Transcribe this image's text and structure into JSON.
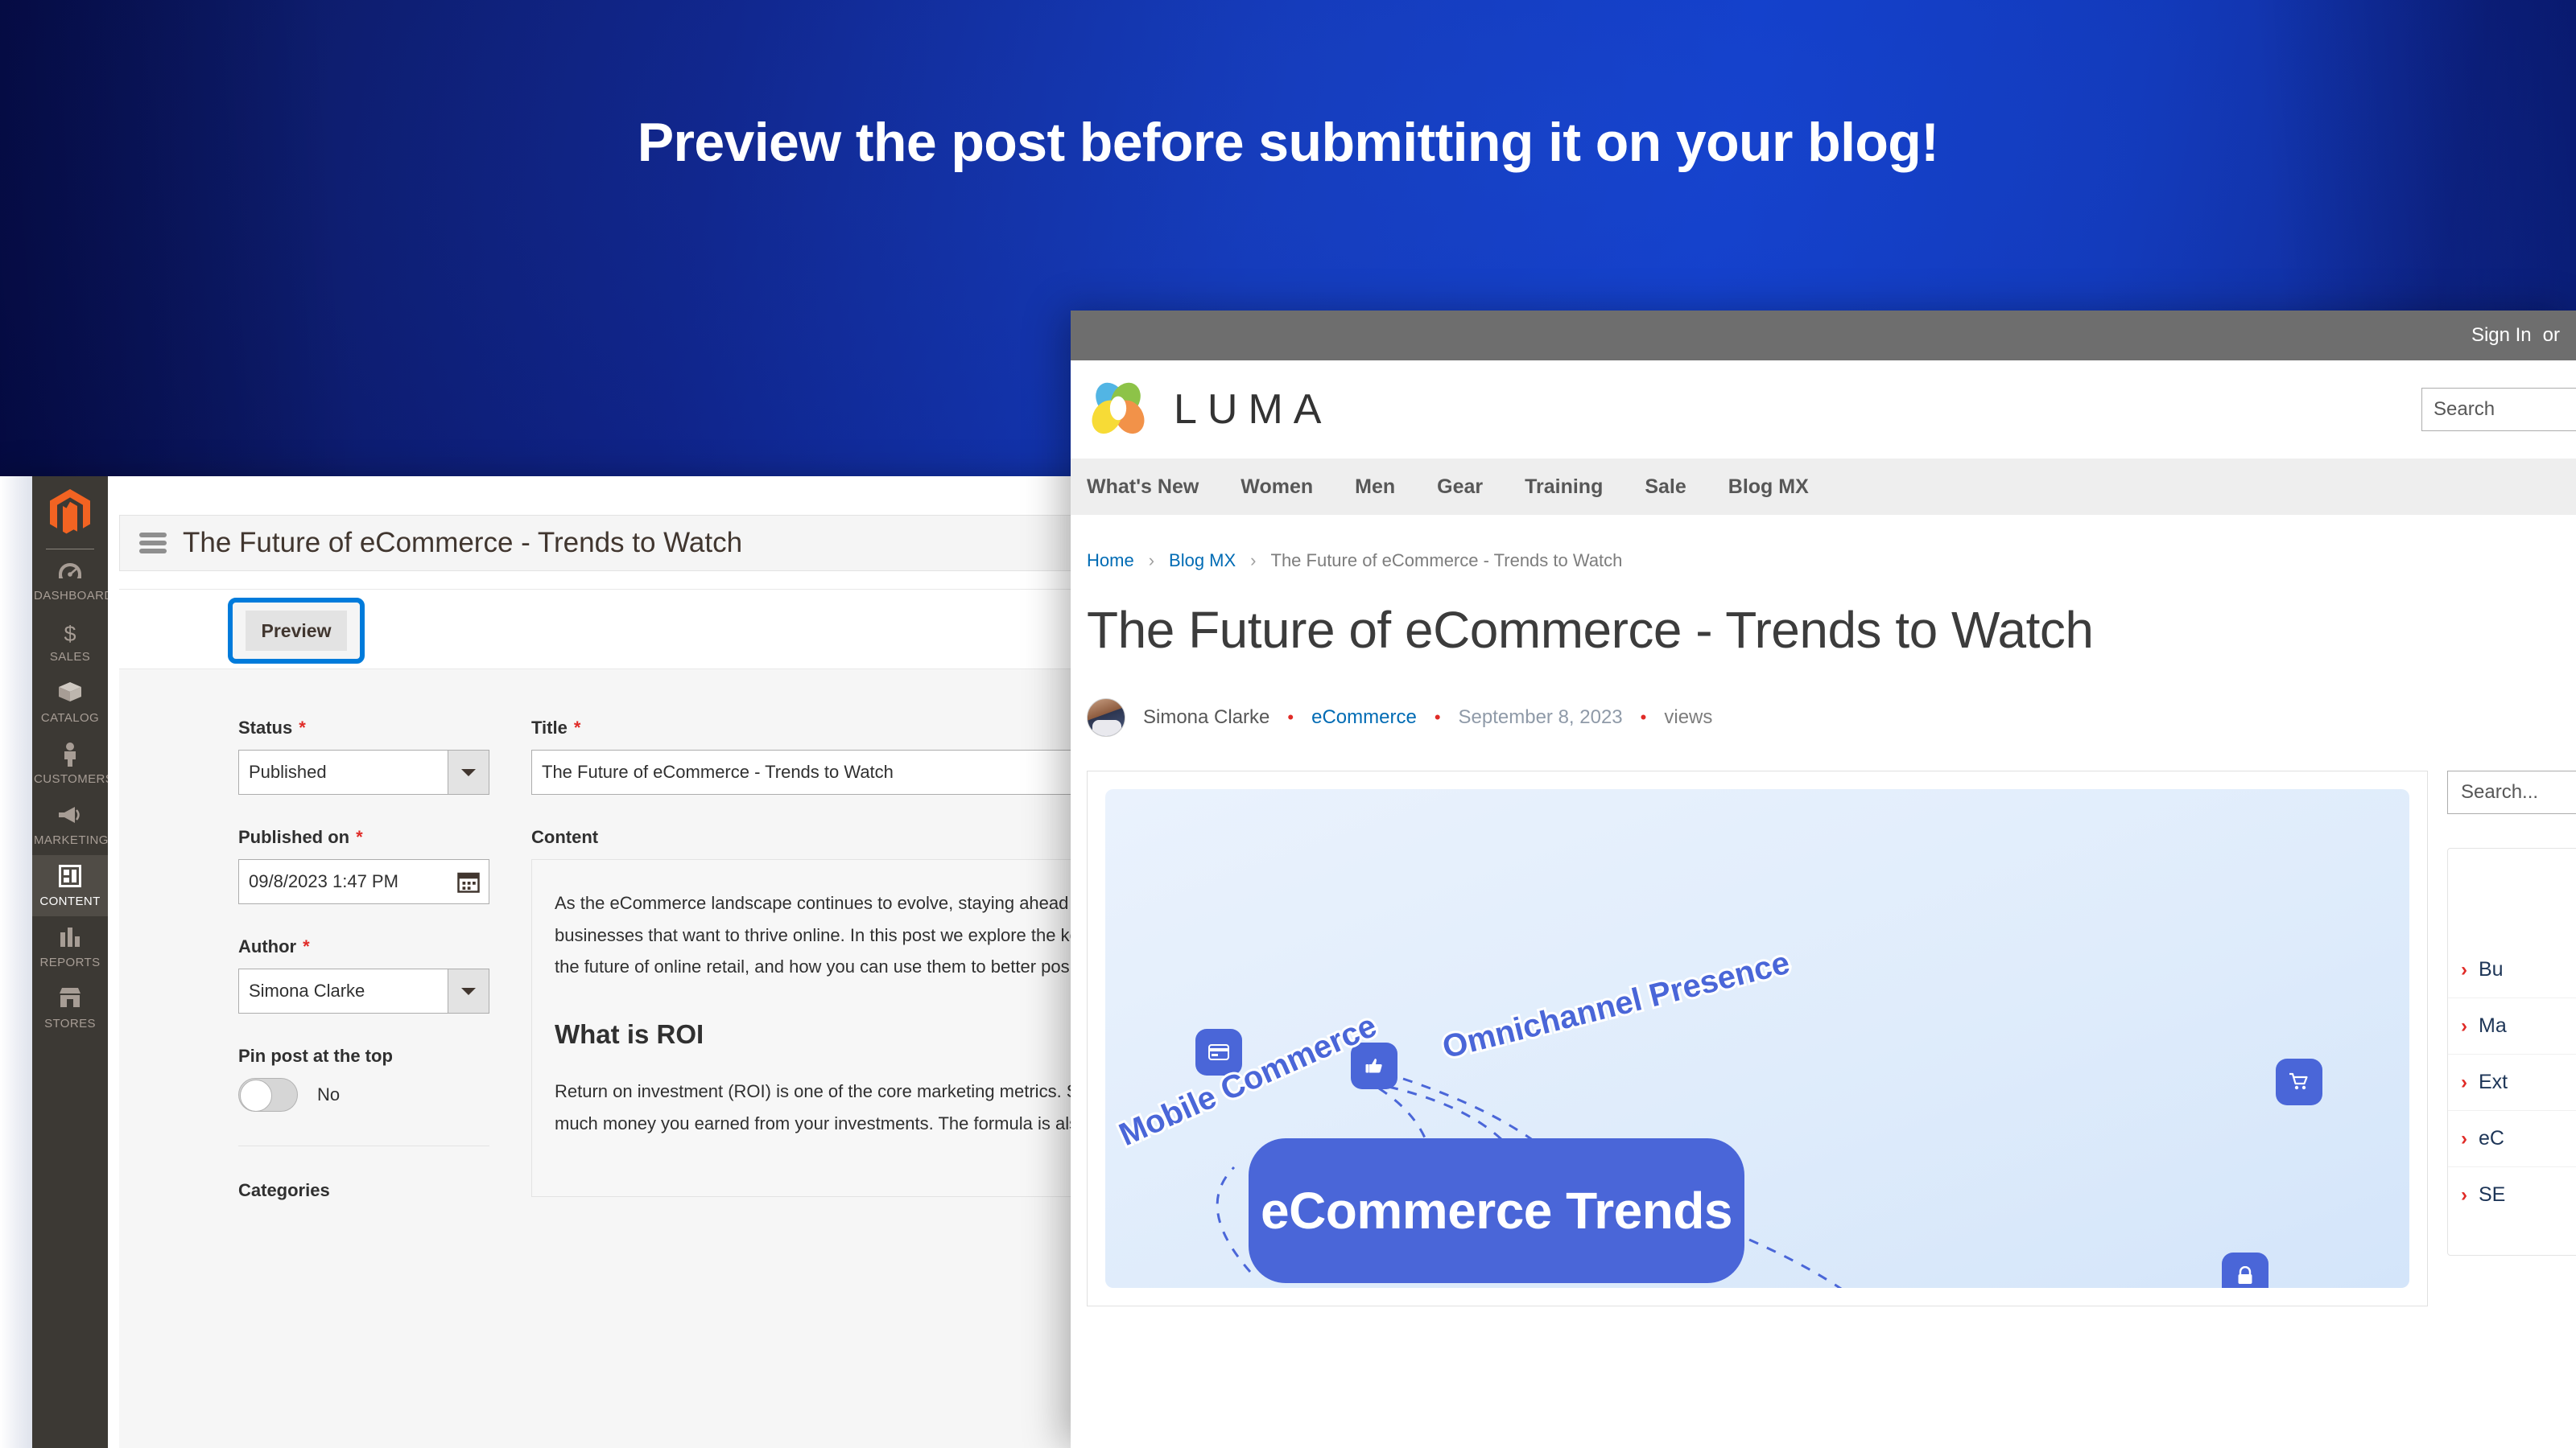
{
  "hero": {
    "title": "Preview the post before submitting it on your blog!"
  },
  "admin": {
    "logo_icon": "magento-logo-icon",
    "page_title": "The Future of eCommerce - Trends to Watch",
    "hamburger_icon": "hamburger-menu-icon",
    "preview_button": "Preview",
    "sidebar": [
      {
        "label": "DASHBOARD",
        "icon": "gauge-icon",
        "active": false
      },
      {
        "label": "SALES",
        "icon": "dollar-icon",
        "active": false
      },
      {
        "label": "CATALOG",
        "icon": "box-icon",
        "active": false
      },
      {
        "label": "CUSTOMERS",
        "icon": "person-icon",
        "active": false
      },
      {
        "label": "MARKETING",
        "icon": "megaphone-icon",
        "active": false
      },
      {
        "label": "CONTENT",
        "icon": "layout-icon",
        "active": true
      },
      {
        "label": "REPORTS",
        "icon": "bar-chart-icon",
        "active": false
      },
      {
        "label": "STORES",
        "icon": "storefront-icon",
        "active": false
      }
    ],
    "form": {
      "status_label": "Status",
      "status_required": "*",
      "status_value": "Published",
      "published_on_label": "Published on",
      "published_on_required": "*",
      "published_on_value": "09/8/2023 1:47 PM",
      "calendar_icon": "calendar-icon",
      "author_label": "Author",
      "author_required": "*",
      "author_value": "Simona Clarke",
      "pin_label": "Pin post at the top",
      "pin_value": "No",
      "categories_label": "Categories",
      "title_label": "Title",
      "title_required": "*",
      "title_value": "The Future of eCommerce - Trends to Watch",
      "content_label": "Content",
      "content_paragraph_1": "As the eCommerce landscape continues to evolve, staying ahead of the curve is essential for businesses that want to thrive online. In this post we explore the key trends that are shaping the future of online retail, and how you can use them to better position your online business.",
      "content_heading": "What is ROI",
      "content_paragraph_2": "Return on investment (ROI) is one of the core marketing metrics. Simply said: ROI shows how much money you earned from your investments. The formula is also quite simple:"
    }
  },
  "luma": {
    "topbar": {
      "sign_in": "Sign In",
      "or": "or"
    },
    "brand": "LUMA",
    "brand_logo_icon": "luma-rings-icon",
    "header_search_placeholder": "Search",
    "nav": [
      "What's New",
      "Women",
      "Men",
      "Gear",
      "Training",
      "Sale",
      "Blog MX"
    ],
    "breadcrumb": [
      {
        "label": "Home",
        "link": true
      },
      {
        "label": "Blog MX",
        "link": true
      },
      {
        "label": "The Future of eCommerce - Trends to Watch",
        "link": false
      }
    ],
    "breadcrumb_separator": "›",
    "post": {
      "title": "The Future of eCommerce - Trends to Watch",
      "author": "Simona Clarke",
      "author_avatar_icon": "avatar-icon",
      "category": "eCommerce",
      "date": "September 8, 2023",
      "views": "views",
      "separator": "•"
    },
    "infographic": {
      "center_label": "eCommerce Trends",
      "labels": [
        {
          "text": "Mobile Commerce",
          "rotation": -24
        },
        {
          "text": "Omnichannel Presence",
          "rotation": -14
        }
      ],
      "badges": [
        {
          "icon": "credit-card-icon",
          "glyph": "▤"
        },
        {
          "icon": "thumbs-up-icon",
          "glyph": "👍"
        },
        {
          "icon": "shopping-cart-icon",
          "glyph": "🛒"
        },
        {
          "icon": "lock-icon",
          "glyph": "🔒"
        }
      ]
    },
    "aside": {
      "search_placeholder": "Search...",
      "links": [
        {
          "chevron": "›",
          "label": "Bu"
        },
        {
          "chevron": "›",
          "label": "Ma"
        },
        {
          "chevron": "›",
          "label": "Ext"
        },
        {
          "chevron": "›",
          "label": "eC"
        },
        {
          "chevron": "›",
          "label": "SE"
        }
      ]
    }
  },
  "colors": {
    "magento_orange": "#f26322",
    "admin_sidebar": "#3c3934",
    "focus_blue": "#007bdb",
    "link_blue": "#006bb4",
    "required_red": "#e02b27",
    "infographic_blue": "#4a66d8"
  }
}
